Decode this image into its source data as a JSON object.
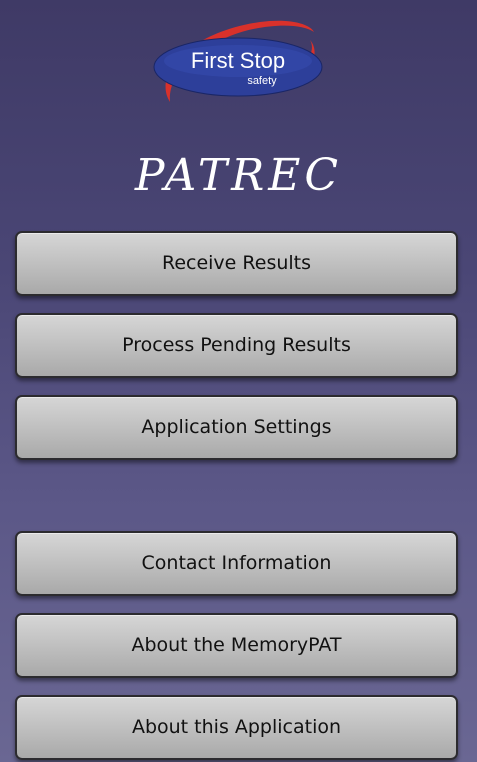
{
  "logo": {
    "line1": "First Stop",
    "line2": "safety",
    "colors": {
      "oval": "#2d3f9a",
      "swoosh": "#d9312b",
      "text": "#ffffff"
    }
  },
  "app_title": "PATREC",
  "menu": {
    "receive_results": "Receive Results",
    "process_pending": "Process Pending Results",
    "app_settings": "Application Settings",
    "contact_info": "Contact Information",
    "about_memorypat": "About the MemoryPAT",
    "about_app": "About this Application"
  }
}
